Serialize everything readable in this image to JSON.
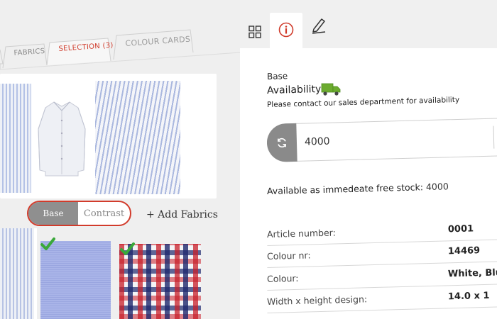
{
  "left_panel": {
    "tabs": [
      {
        "label": "FABRICS"
      },
      {
        "label": "SELECTION (3)"
      },
      {
        "label": "COLOUR CARDS"
      }
    ],
    "segment": {
      "base": "Base",
      "contrast": "Contrast",
      "selected": "Base"
    },
    "add_fabrics_label": "+ Add Fabrics"
  },
  "right_panel": {
    "icons": [
      "grid-icon",
      "info-icon",
      "edit-icon"
    ],
    "active_icon": "info-icon",
    "section_label": "Base",
    "availability_label": "Availability:",
    "contact_text": "Please contact our sales department for availability",
    "quantity_value": "4000",
    "stock_label": "Available as immedeate free stock:",
    "stock_value": "4000",
    "specs": [
      {
        "label": "Article number:",
        "value": "0001"
      },
      {
        "label": "Colour nr:",
        "value": "14469"
      },
      {
        "label": "Colour:",
        "value": "White, Blu"
      },
      {
        "label": "Width x height design:",
        "value": "14.0 x 1"
      }
    ]
  },
  "colors": {
    "accent": "#d03a2a",
    "segment_selected_bg": "#8f8f8f",
    "check_green": "#3aa83a",
    "truck_green": "#6cab2f",
    "left_bg": "#efefef"
  }
}
